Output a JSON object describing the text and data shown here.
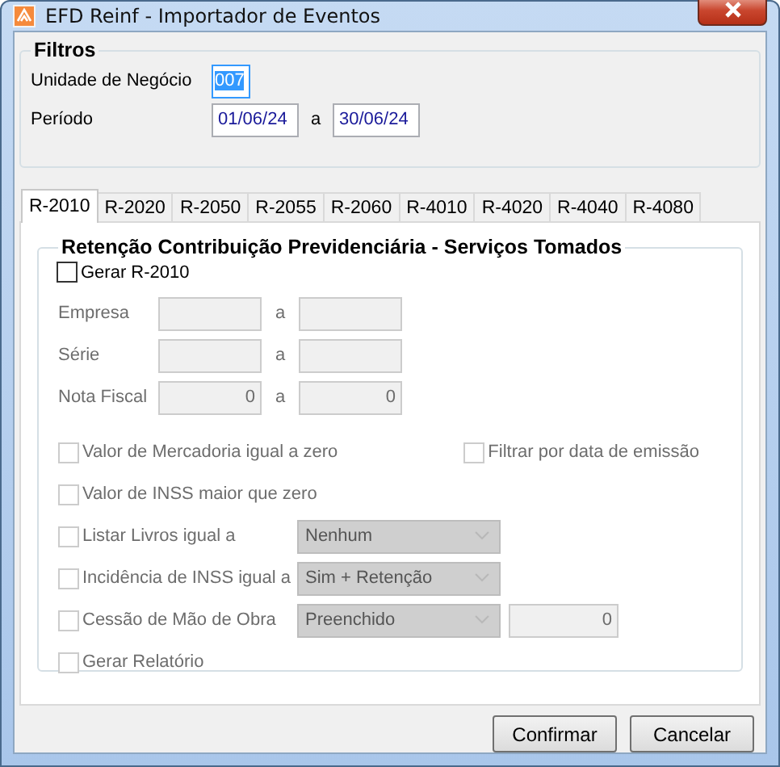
{
  "window": {
    "title": "EFD Reinf - Importador de Eventos"
  },
  "filters": {
    "title": "Filtros",
    "business_unit": {
      "label": "Unidade de Negócio",
      "value": "007",
      "focused": true
    },
    "period": {
      "label": "Período",
      "from": "01/06/24",
      "separator": "a",
      "to": "30/06/24"
    }
  },
  "tabs": [
    {
      "label": "R-2010",
      "selected": true
    },
    {
      "label": "R-2020",
      "selected": false
    },
    {
      "label": "R-2050",
      "selected": false
    },
    {
      "label": "R-2055",
      "selected": false
    },
    {
      "label": "R-2060",
      "selected": false
    },
    {
      "label": "R-4010",
      "selected": false
    },
    {
      "label": "R-4020",
      "selected": false
    },
    {
      "label": "R-4040",
      "selected": false
    },
    {
      "label": "R-4080",
      "selected": false
    }
  ],
  "panel": {
    "title": "Retenção Contribuição Previdenciária - Serviços Tomados",
    "generate": {
      "label": "Gerar R-2010",
      "checked": false,
      "disabled": false
    },
    "ranges": [
      {
        "label": "Empresa",
        "separator": "a",
        "disabled": true
      },
      {
        "label": "Série",
        "separator": "a",
        "disabled": true
      },
      {
        "label": "Nota Fiscal",
        "from": "0",
        "separator": "a",
        "to": "0",
        "disabled": true
      }
    ],
    "option_rows": [
      {
        "items": [
          {
            "kind": "check",
            "label": "Valor de Mercadoria igual a zero",
            "checked": false,
            "disabled": true
          },
          {
            "kind": "check",
            "label": "Filtrar por data de emissão",
            "checked": false,
            "disabled": true
          }
        ]
      },
      {
        "items": [
          {
            "kind": "check",
            "label": "Valor de INSS maior que zero",
            "checked": false,
            "disabled": true
          }
        ]
      },
      {
        "items": [
          {
            "kind": "check",
            "label": "Listar Livros igual a",
            "checked": false,
            "disabled": true
          },
          {
            "kind": "select",
            "value": "Nenhum",
            "disabled": true
          }
        ]
      },
      {
        "items": [
          {
            "kind": "check",
            "label": "Incidência de INSS igual a",
            "checked": false,
            "disabled": true
          },
          {
            "kind": "select",
            "value": "Sim + Retenção",
            "disabled": true
          }
        ]
      },
      {
        "items": [
          {
            "kind": "check",
            "label": "Cessão de Mão de Obra",
            "checked": false,
            "disabled": true
          },
          {
            "kind": "select",
            "value": "Preenchido",
            "disabled": true
          },
          {
            "kind": "number",
            "value": "0",
            "disabled": true
          }
        ]
      },
      {
        "items": [
          {
            "kind": "check",
            "label": "Gerar Relatório",
            "checked": false,
            "disabled": true
          }
        ]
      }
    ]
  },
  "buttons": [
    {
      "label": "Confirmar"
    },
    {
      "label": "Cancelar"
    }
  ]
}
